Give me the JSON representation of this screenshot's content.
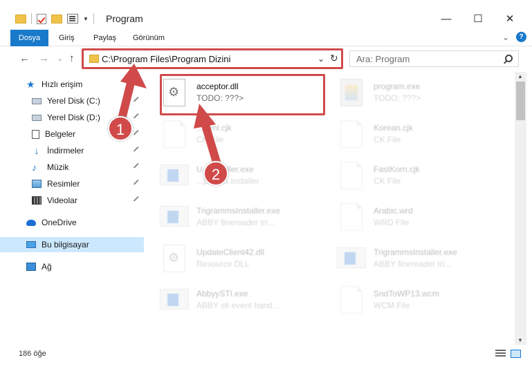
{
  "window": {
    "title": "Program",
    "minimize": "—",
    "maximize": "☐",
    "close": "✕"
  },
  "ribbon": {
    "tabs": [
      "Dosya",
      "Giriş",
      "Paylaş",
      "Görünüm"
    ],
    "expand": "⌄",
    "help": "?"
  },
  "nav": {
    "back": "←",
    "forward": "→",
    "recent": "⌄",
    "up": "↑",
    "address": "C:\\Program Files\\Program Dizini",
    "address_chevron": "⌄",
    "refresh": "↻",
    "search_placeholder": "Ara: Program"
  },
  "sidebar": {
    "items": [
      {
        "label": "Hızlı erişim"
      },
      {
        "label": "Yerel Disk (C:)"
      },
      {
        "label": "Yerel Disk (D:)"
      },
      {
        "label": "Belgeler"
      },
      {
        "label": "İndirmeler"
      },
      {
        "label": "Müzik"
      },
      {
        "label": "Resimler"
      },
      {
        "label": "Videolar"
      },
      {
        "label": "OneDrive"
      },
      {
        "label": "Bu bilgisayar"
      },
      {
        "label": "Ağ"
      }
    ]
  },
  "files": [
    {
      "name": "acceptor.dll",
      "type": "TODO: ???>",
      "icon": "dll-icon"
    },
    {
      "name": "program.exe",
      "type": "TODO: ???>",
      "icon": "exe-icon"
    },
    {
      "name": "...html.cjk",
      "type": "CK File",
      "icon": "file-icon"
    },
    {
      "name": "Korean.cjk",
      "type": "CK File",
      "icon": "file-icon"
    },
    {
      "name": "U...Installer.exe",
      "type": "...pdates installer",
      "icon": "exe-icon"
    },
    {
      "name": "FastKorn.cjk",
      "type": "CK File",
      "icon": "file-icon"
    },
    {
      "name": "TrigrammsInstaller.exe",
      "type": "ABBY finereader tri...",
      "icon": "exe-icon"
    },
    {
      "name": "Arabic.wrd",
      "type": "WRD File",
      "icon": "file-icon"
    },
    {
      "name": "UpdateClient42.dll",
      "type": "Resource DLL",
      "icon": "dll-icon"
    },
    {
      "name": "TrigrammsInstaller.exe",
      "type": "ABBY finereader tri...",
      "icon": "exe-icon"
    },
    {
      "name": "AbbyySTI.exe",
      "type": "ABBY sti event hand...",
      "icon": "exe-icon"
    },
    {
      "name": "SndToWP13.wcm",
      "type": "WCM File",
      "icon": "file-icon"
    }
  ],
  "status": {
    "count": "186 öğe"
  },
  "callouts": [
    "1",
    "2"
  ],
  "colors": {
    "accent": "#1979ca",
    "highlight": "#d04a4a",
    "selection": "#cce8ff"
  }
}
